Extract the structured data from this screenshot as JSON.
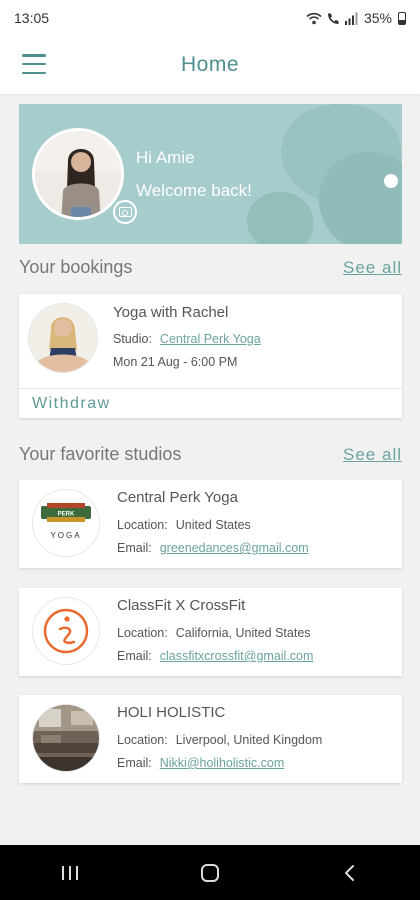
{
  "status_bar": {
    "time": "13:05",
    "battery": "35%"
  },
  "header": {
    "title": "Home",
    "menu_icon": "hamburger-menu-icon"
  },
  "hero": {
    "greeting": "Hi Amie",
    "welcome": "Welcome back!",
    "background_color": "#a6cdcb"
  },
  "bookings": {
    "title": "Your bookings",
    "see_all": "See all",
    "items": [
      {
        "class_name": "Yoga with Rachel",
        "studio_label": "Studio:",
        "studio_name": "Central Perk Yoga",
        "datetime": "Mon 21 Aug - 6:00 PM",
        "withdraw_label": "Withdraw"
      }
    ]
  },
  "favorites": {
    "title": "Your favorite studios",
    "see_all": "See all",
    "items": [
      {
        "name": "Central Perk Yoga",
        "location_label": "Location:",
        "location": "United States",
        "email_label": "Email:",
        "email": "greenedances@gmail.com",
        "logo_text": "YOGA"
      },
      {
        "name": "ClassFit X CrossFit",
        "location_label": "Location:",
        "location": "California, United States",
        "email_label": "Email:",
        "email": "classfitxcrossfit@gmail.com"
      },
      {
        "name": "HOLI HOLISTIC",
        "location_label": "Location:",
        "location": "Liverpool, United Kingdom",
        "email_label": "Email:",
        "email": "Nikki@holiholistic.com"
      }
    ]
  },
  "colors": {
    "accent": "#5e9c99",
    "link": "#6aa3a0",
    "title": "#4f8f8f"
  }
}
